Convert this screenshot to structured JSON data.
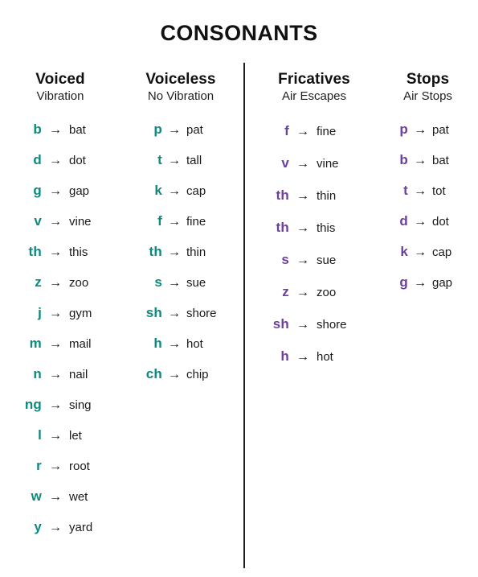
{
  "title": "CONSONANTS",
  "colors": {
    "voiced_teal": "#0d8a7d",
    "fricative_purple": "#6b3fa0",
    "text_black": "#1a1a1a",
    "divider": "#1d1d1d",
    "background": "#ffffff"
  },
  "arrow_glyph": "→",
  "columns": [
    {
      "id": "voiced",
      "heading": "Voiced",
      "subheading": "Vibration",
      "color": "#0d8a7d",
      "rows": [
        {
          "symbol": "b",
          "word": "bat"
        },
        {
          "symbol": "d",
          "word": "dot"
        },
        {
          "symbol": "g",
          "word": "gap"
        },
        {
          "symbol": "v",
          "word": "vine"
        },
        {
          "symbol": "th",
          "word": "this"
        },
        {
          "symbol": "z",
          "word": "zoo"
        },
        {
          "symbol": "j",
          "word": "gym"
        },
        {
          "symbol": "m",
          "word": "mail"
        },
        {
          "symbol": "n",
          "word": "nail"
        },
        {
          "symbol": "ng",
          "word": "sing"
        },
        {
          "symbol": "l",
          "word": "let"
        },
        {
          "symbol": "r",
          "word": "root"
        },
        {
          "symbol": "w",
          "word": "wet"
        },
        {
          "symbol": "y",
          "word": "yard"
        }
      ]
    },
    {
      "id": "voiceless",
      "heading": "Voiceless",
      "subheading": "No Vibration",
      "color": "#0d8a7d",
      "rows": [
        {
          "symbol": "p",
          "word": "pat"
        },
        {
          "symbol": "t",
          "word": "tall"
        },
        {
          "symbol": "k",
          "word": "cap"
        },
        {
          "symbol": "f",
          "word": "fine"
        },
        {
          "symbol": "th",
          "word": "thin"
        },
        {
          "symbol": "s",
          "word": "sue"
        },
        {
          "symbol": "sh",
          "word": "shore"
        },
        {
          "symbol": "h",
          "word": "hot"
        },
        {
          "symbol": "ch",
          "word": "chip"
        }
      ]
    },
    {
      "id": "fricatives",
      "heading": "Fricatives",
      "subheading": "Air Escapes",
      "color": "#6b3fa0",
      "rows": [
        {
          "symbol": "f",
          "word": "fine"
        },
        {
          "symbol": "v",
          "word": "vine"
        },
        {
          "symbol": "th",
          "word": "thin"
        },
        {
          "symbol": "th",
          "word": "this"
        },
        {
          "symbol": "s",
          "word": "sue"
        },
        {
          "symbol": "z",
          "word": "zoo"
        },
        {
          "symbol": "sh",
          "word": "shore"
        },
        {
          "symbol": "h",
          "word": "hot"
        }
      ]
    },
    {
      "id": "stops",
      "heading": "Stops",
      "subheading": "Air Stops",
      "color": "#6b3fa0",
      "rows": [
        {
          "symbol": "p",
          "word": "pat"
        },
        {
          "symbol": "b",
          "word": "bat"
        },
        {
          "symbol": "t",
          "word": "tot"
        },
        {
          "symbol": "d",
          "word": "dot"
        },
        {
          "symbol": "k",
          "word": "cap"
        },
        {
          "symbol": "g",
          "word": "gap"
        }
      ]
    }
  ]
}
